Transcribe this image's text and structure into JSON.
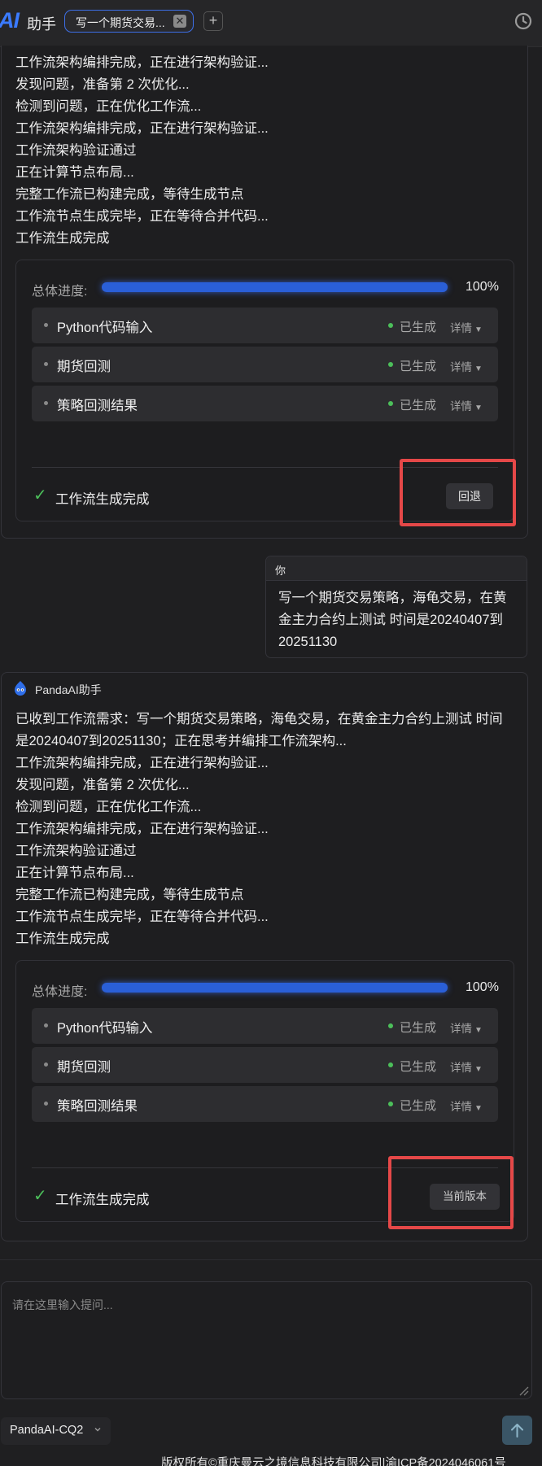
{
  "topbar": {
    "logo": "AI",
    "app_name": "助手",
    "tab_label": "写一个期货交易...",
    "tab_close": "✕",
    "tab_add": "+"
  },
  "messages": [
    {
      "lines": [
        "工作流架构编排完成，正在进行架构验证...",
        "发现问题，准备第 2 次优化...",
        "检测到问题，正在优化工作流...",
        "工作流架构编排完成，正在进行架构验证...",
        "工作流架构验证通过",
        "正在计算节点布局...",
        "完整工作流已构建完成，等待生成节点",
        "工作流节点生成完毕，正在等待合并代码...",
        "工作流生成完成"
      ],
      "progress": {
        "label": "总体进度:",
        "value": 1.0,
        "percent_text": "100%",
        "nodes": [
          {
            "name": "Python代码输入",
            "status": "已生成",
            "detail": "详情"
          },
          {
            "name": "期货回测",
            "status": "已生成",
            "detail": "详情"
          },
          {
            "name": "策略回测结果",
            "status": "已生成",
            "detail": "详情"
          }
        ],
        "done_text": "工作流生成完成",
        "action_label": "回退"
      }
    },
    {
      "sender": "PandaAI助手",
      "lines": [
        "已收到工作流需求：写一个期货交易策略，海龟交易，在黄金主力合约上测试 时间",
        "是20240407到20251130；正在思考并编排工作流架构...",
        "工作流架构编排完成，正在进行架构验证...",
        "发现问题，准备第 2 次优化...",
        "检测到问题，正在优化工作流...",
        "工作流架构编排完成，正在进行架构验证...",
        "工作流架构验证通过",
        "正在计算节点布局...",
        "完整工作流已构建完成，等待生成节点",
        "工作流节点生成完毕，正在等待合并代码...",
        "工作流生成完成"
      ],
      "progress": {
        "label": "总体进度:",
        "value": 1.0,
        "percent_text": "100%",
        "nodes": [
          {
            "name": "Python代码输入",
            "status": "已生成",
            "detail": "详情"
          },
          {
            "name": "期货回测",
            "status": "已生成",
            "detail": "详情"
          },
          {
            "name": "策略回测结果",
            "status": "已生成",
            "detail": "详情"
          }
        ],
        "done_text": "工作流生成完成",
        "action_label": "当前版本"
      }
    }
  ],
  "user_message": {
    "sender": "你",
    "lines": [
      "写一个期货交易策略，海龟交易，在黄",
      "金主力合约上测试 时间是20240407到",
      "20251130"
    ]
  },
  "composer": {
    "placeholder": "请在这里输入提问...",
    "model": "PandaAI-CQ2"
  },
  "footer": {
    "text": "版权所有©重庆曼云之境信息科技有限公司|渝ICP备2024046061号"
  },
  "colors": {
    "accent": "#3b7bff",
    "progress_fill": "#2a5fd8",
    "success": "#4cbf5a",
    "highlight": "#e54848",
    "background": "#1f1f21"
  },
  "icons": {
    "history": "clock-history-icon",
    "send": "arrow-up-icon",
    "avatar": "panda-logo-icon",
    "check": "check-icon"
  }
}
